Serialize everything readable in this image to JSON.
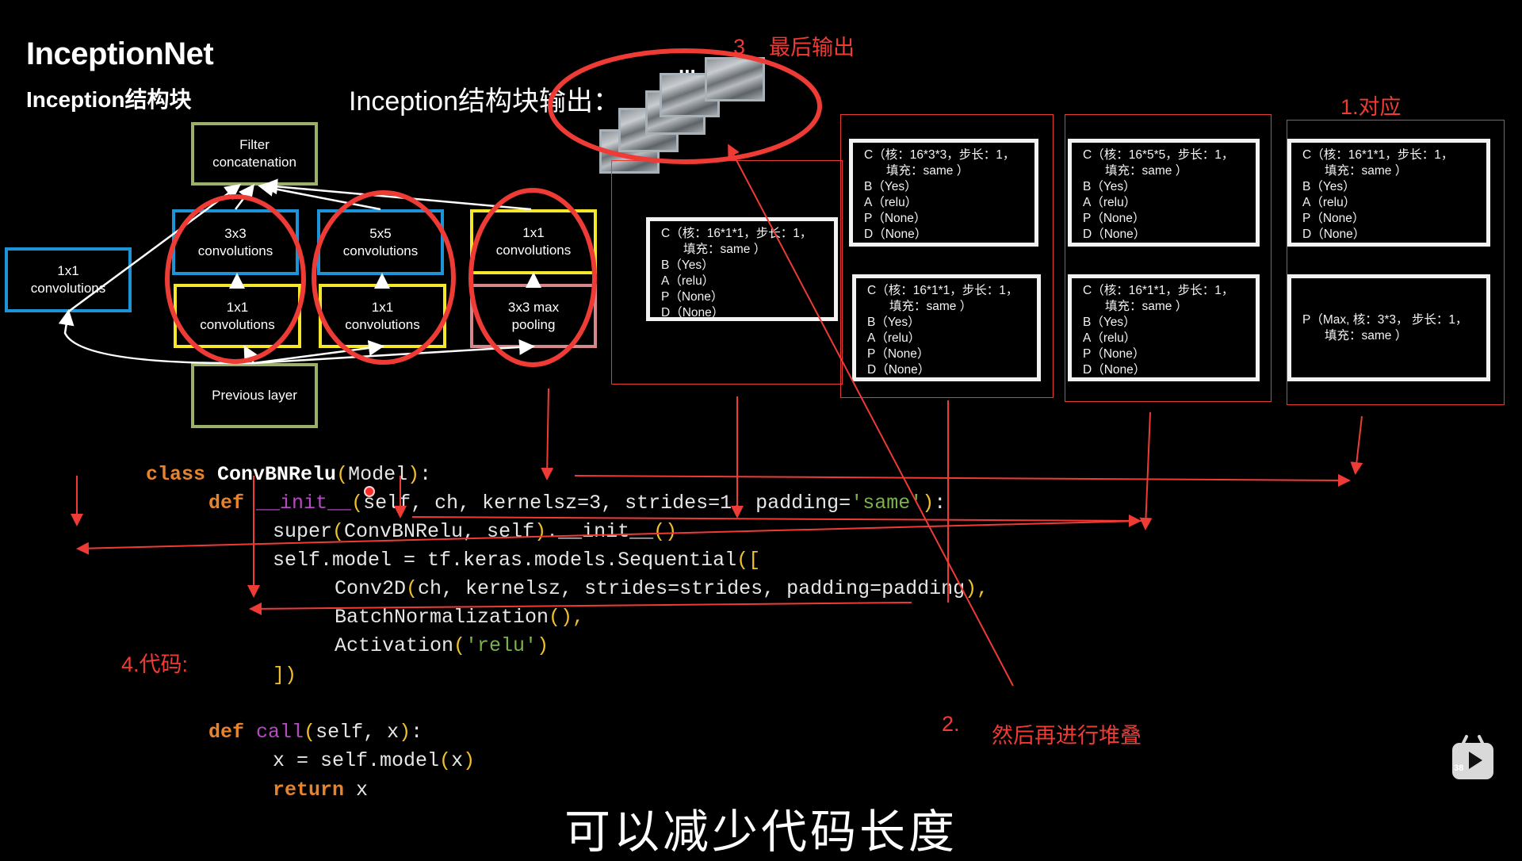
{
  "slide": {
    "title": "InceptionNet",
    "subtitle": "Inception结构块",
    "output_title": "Inception结构块输出："
  },
  "diagram": {
    "filter_concat": "Filter\nconcatenation",
    "previous_layer": "Previous layer",
    "branch1": [
      "1x1\nconvolutions"
    ],
    "branch2": [
      "3x3\nconvolutions",
      "1x1\nconvolutions"
    ],
    "branch3": [
      "5x5\nconvolutions",
      "1x1\nconvolutions"
    ],
    "branch4": [
      "1x1\nconvolutions",
      "3x3 max\npooling"
    ],
    "output_ellipsis": "..."
  },
  "specs": {
    "branch1": {
      "c1": "C（核：16*1*1，步长：1，",
      "c2": "填充：same ）",
      "b": "B（Yes）",
      "a": "A（relu）",
      "p": "P（None）",
      "d": "D（None）"
    },
    "branch2_top": {
      "c1": "C（核：16*3*3，步长：1，",
      "c2": "填充：same ）",
      "b": "B（Yes）",
      "a": "A（relu）",
      "p": "P（None）",
      "d": "D（None）"
    },
    "branch2_bottom": {
      "c1": "C（核：16*1*1，步长：1，",
      "c2": "填充：same ）",
      "b": "B（Yes）",
      "a": "A（relu）",
      "p": "P（None）",
      "d": "D（None）"
    },
    "branch3_top": {
      "c1": "C（核：16*5*5，步长：1，",
      "c2": "填充：same ）",
      "b": "B（Yes）",
      "a": "A（relu）",
      "p": "P（None）",
      "d": "D（None）"
    },
    "branch3_bottom": {
      "c1": "C（核：16*1*1，步长：1，",
      "c2": "填充：same ）",
      "b": "B（Yes）",
      "a": "A（relu）",
      "p": "P（None）",
      "d": "D（None）"
    },
    "branch4_top": {
      "c1": "C（核：16*1*1，步长：1，",
      "c2": "填充：same ）",
      "b": "B（Yes）",
      "a": "A（relu）",
      "p": "P（None）",
      "d": "D（None）"
    },
    "branch4_bottom": {
      "p1": "P（Max, 核：3*3， 步长：1，",
      "p2": "填充：same ）"
    }
  },
  "annotations": {
    "step1": "1.对应",
    "step2_num": "2.",
    "step2_text": "然后再进行堆叠",
    "step3_num": "3",
    "step3_text": "最后输出",
    "step4": "4.代码:"
  },
  "code": {
    "l1": {
      "kw": "class",
      "name": "ConvBNRelu",
      "p1": "(",
      "base": "Model",
      "p2": ")",
      "end": ":"
    },
    "l2": {
      "kw": "def",
      "fn": "__init__",
      "p1": "(",
      "args": "self, ch, kernelsz=3, strides=1, padding=",
      "str": "'same'",
      "p2": ")",
      "end": ":"
    },
    "l3": {
      "a": "super",
      "p1": "(",
      "b": "ConvBNRelu, self",
      "p2": ")",
      "c": ".__init__",
      "p3": "()"
    },
    "l4": {
      "a": "self.model = tf.keras.models.Sequential",
      "p": "(["
    },
    "l5": {
      "a": "Conv2D",
      "p1": "(",
      "b": "ch, kernelsz, strides=strides, padding=padding",
      "p2": ")",
      "c": ","
    },
    "l6": {
      "a": "BatchNormalization",
      "p": "()",
      "c": ","
    },
    "l7": {
      "a": "Activation",
      "p1": "(",
      "str": "'relu'",
      "p2": ")"
    },
    "l8": {
      "p": "])"
    },
    "l9": {
      "kw": "def",
      "fn": "call",
      "p1": "(",
      "args": "self, x",
      "p2": ")",
      "end": ":"
    },
    "l10": {
      "a": "x = self.model",
      "p1": "(",
      "b": "x",
      "p2": ")"
    },
    "l11": {
      "kw": "return",
      "a": " x"
    }
  },
  "subtitle_caption": "可以减少代码长度",
  "player": {
    "badge": "38",
    "icon": "bilibili-tv-icon"
  },
  "colors": {
    "red": "#ee3b36",
    "blue": "#1d94d8",
    "yellow": "#f5e72c",
    "pink": "#d6878a",
    "green": "#9bb068"
  }
}
